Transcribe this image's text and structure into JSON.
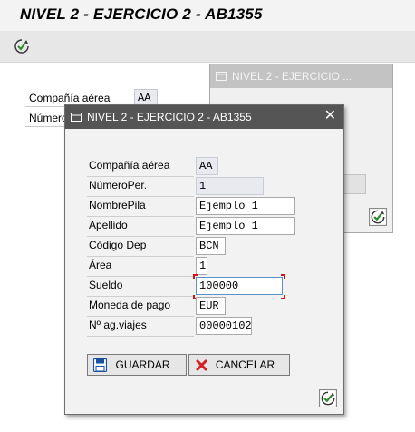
{
  "app": {
    "title": "NIVEL 2 - EJERCICIO 2 - AB1355"
  },
  "background_form": {
    "fields": [
      {
        "label": "Compañía aérea",
        "value": "AA"
      },
      {
        "label": "Número"
      }
    ]
  },
  "back_dialog": {
    "title": "NIVEL 2 - EJERCICIO ..."
  },
  "dialog": {
    "title": "NIVEL 2 - EJERCICIO 2 - AB1355",
    "fields": [
      {
        "label": "Compañía aérea",
        "value": "AA",
        "readonly": true
      },
      {
        "label": "NúmeroPer.",
        "value": "1",
        "readonly": true
      },
      {
        "label": "NombrePila",
        "value": "Ejemplo 1",
        "readonly": false
      },
      {
        "label": "Apellido",
        "value": "Ejemplo 1",
        "readonly": false
      },
      {
        "label": "Código Dep",
        "value": "BCN",
        "readonly": false
      },
      {
        "label": "Área",
        "value": "1",
        "readonly": false
      },
      {
        "label": "Sueldo",
        "value": "100000",
        "readonly": false,
        "focused": true
      },
      {
        "label": "Moneda de pago",
        "value": "EUR",
        "readonly": false
      },
      {
        "label": "Nº ag.viajes",
        "value": "00000102",
        "readonly": false
      }
    ],
    "buttons": {
      "save": "GUARDAR",
      "cancel": "CANCELAR"
    }
  },
  "icons": {
    "toolbar_ok": "check-circle-icon",
    "save": "floppy-disk-icon",
    "cancel": "red-x-icon",
    "close": "close-icon"
  },
  "colors": {
    "dialog_title_bg": "#555555",
    "focus_marker": "#d01515",
    "accent_green": "#2d8a2d"
  }
}
